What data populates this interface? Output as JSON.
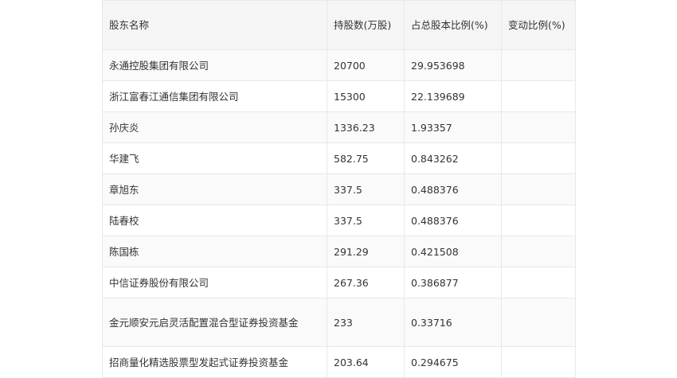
{
  "table": {
    "headers": [
      "股东名称",
      "持股数(万股)",
      "占总股本比例(%)",
      "变动比例(%)"
    ],
    "rows": [
      [
        "永通控股集团有限公司",
        "20700",
        "29.953698",
        ""
      ],
      [
        "浙江富春江通信集团有限公司",
        "15300",
        "22.139689",
        ""
      ],
      [
        "孙庆炎",
        "1336.23",
        "1.93357",
        ""
      ],
      [
        "华建飞",
        "582.75",
        "0.843262",
        ""
      ],
      [
        "章旭东",
        "337.5",
        "0.488376",
        ""
      ],
      [
        "陆春校",
        "337.5",
        "0.488376",
        ""
      ],
      [
        "陈国栋",
        "291.29",
        "0.421508",
        ""
      ],
      [
        "中信证券股份有限公司",
        "267.36",
        "0.386877",
        ""
      ],
      [
        "金元顺安元启灵活配置混合型证券投资基金",
        "233",
        "0.33716",
        ""
      ],
      [
        "招商量化精选股票型发起式证券投资基金",
        "203.64",
        "0.294675",
        ""
      ]
    ]
  }
}
